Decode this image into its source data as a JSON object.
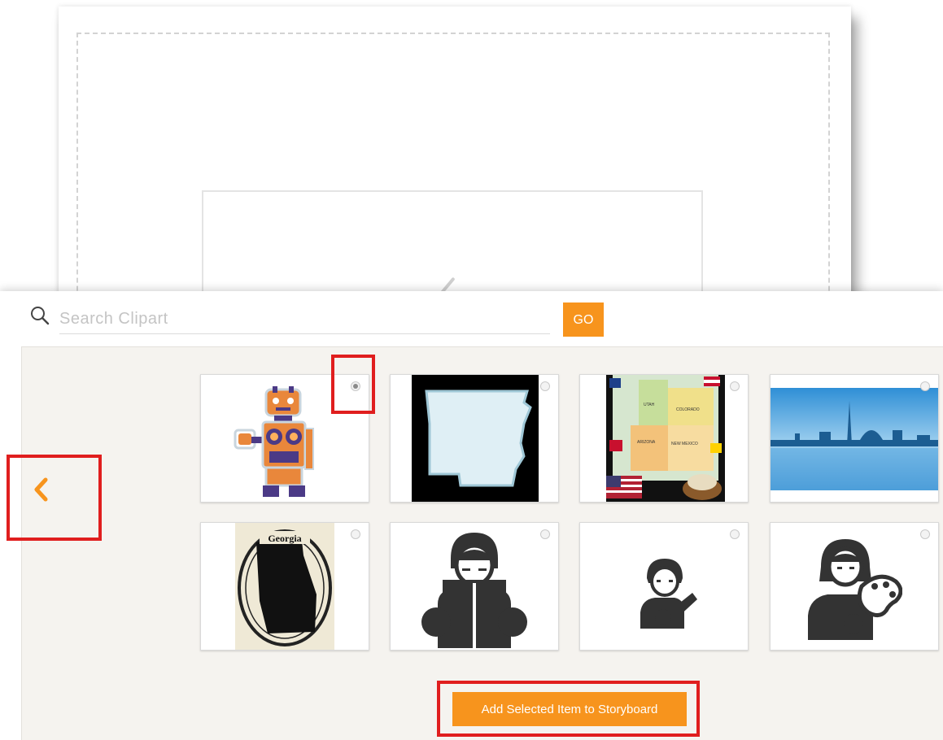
{
  "search": {
    "placeholder": "Search Clipart",
    "value": "",
    "go_label": "GO"
  },
  "nav": {
    "prev_icon": "chevron-left-icon"
  },
  "clipart_items": [
    {
      "name": "robot",
      "selected": true
    },
    {
      "name": "arkansas-outline",
      "selected": false
    },
    {
      "name": "southwest-states-map",
      "selected": false
    },
    {
      "name": "washington-skyline",
      "selected": false
    },
    {
      "name": "georgia-stamp",
      "selected": false
    },
    {
      "name": "person-reading",
      "selected": false
    },
    {
      "name": "child-painting",
      "selected": false
    },
    {
      "name": "girl-with-palette",
      "selected": false
    }
  ],
  "map_labels": {
    "utah": "UTAH",
    "colorado": "COLORADO",
    "arizona": "ARIZONA",
    "new_mexico": "NEW MEXICO"
  },
  "stamp_label": "Georgia",
  "add_button_label": "Add Selected Item to Storyboard",
  "colors": {
    "accent": "#f7941d",
    "highlight": "#e01e1e",
    "panel_bg": "#f5f3ef"
  }
}
